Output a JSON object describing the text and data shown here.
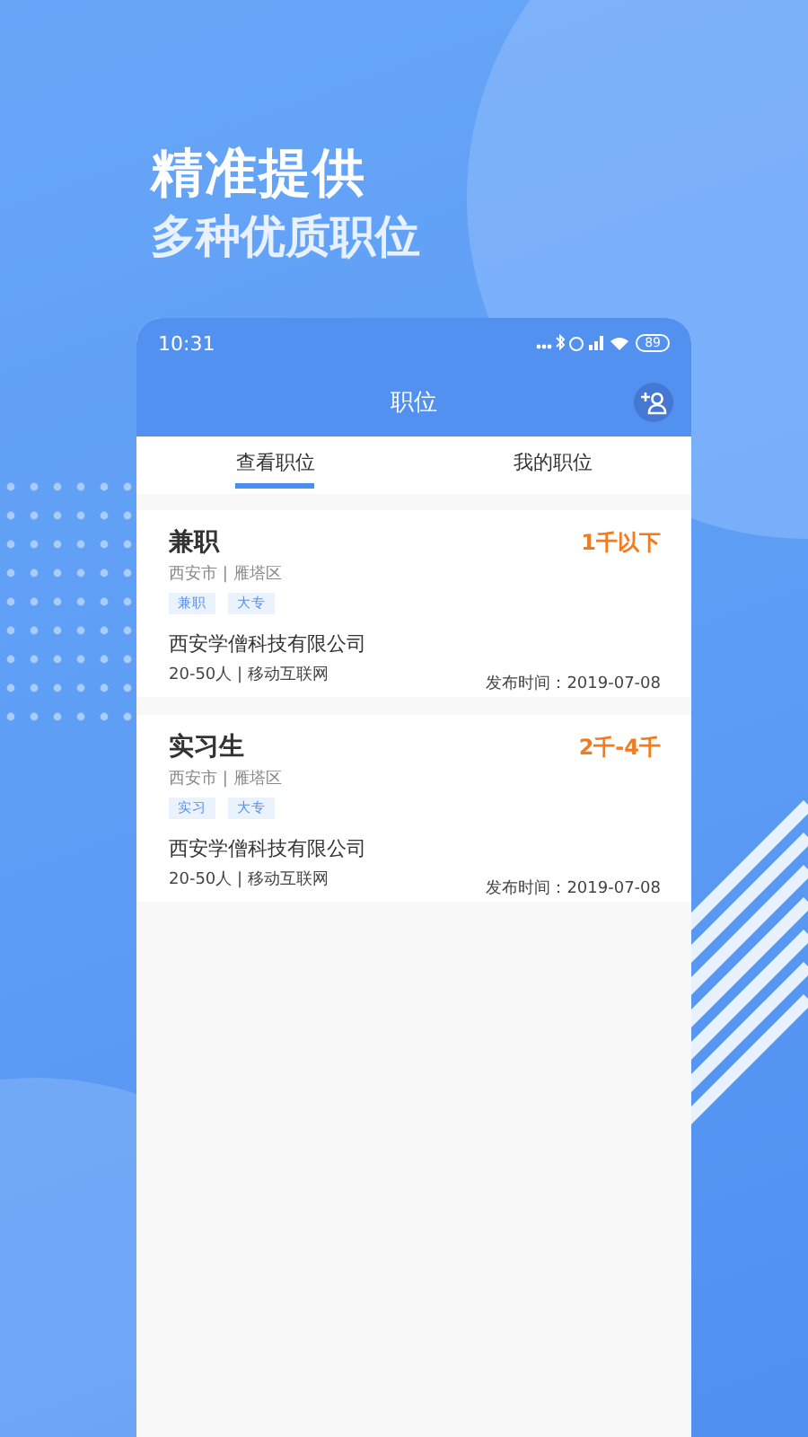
{
  "headline": {
    "line_1": "精准提供",
    "line_2": "多种优质职位"
  },
  "status_bar": {
    "time": "10:31",
    "battery": "89"
  },
  "header": {
    "title": "职位"
  },
  "tabs": [
    {
      "label": "查看职位",
      "selected": true
    },
    {
      "label": "我的职位",
      "selected": false
    }
  ],
  "jobs": [
    {
      "title": "兼职",
      "salary": "1千以下",
      "location": "西安市 | 雁塔区",
      "tags": [
        "兼职",
        "大专"
      ],
      "company": "西安学僧科技有限公司",
      "company_info": "20-50人 | 移动互联网",
      "posted": "发布时间：2019-07-08"
    },
    {
      "title": "实习生",
      "salary": "2千-4千",
      "location": "西安市 | 雁塔区",
      "tags": [
        "实习",
        "大专"
      ],
      "company": "西安学僧科技有限公司",
      "company_info": "20-50人 | 移动互联网",
      "posted": "发布时间：2019-07-08"
    }
  ]
}
